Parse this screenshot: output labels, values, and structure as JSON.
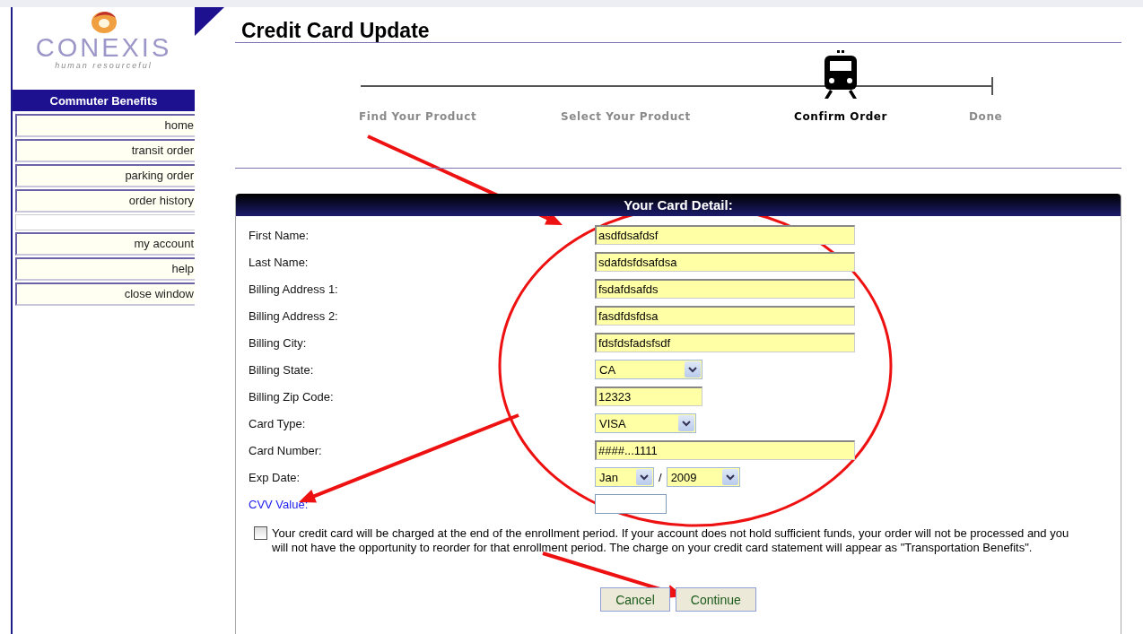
{
  "sidebar": {
    "logo": {
      "name": "CONEXIS",
      "tagline": "human resourceful"
    },
    "heading": "Commuter Benefits",
    "items": [
      {
        "kind": "link",
        "label": "home"
      },
      {
        "kind": "link",
        "label": "transit order"
      },
      {
        "kind": "link",
        "label": "parking order"
      },
      {
        "kind": "link",
        "label": "order history"
      },
      {
        "kind": "spacer"
      },
      {
        "kind": "link",
        "label": "my account"
      },
      {
        "kind": "link",
        "label": "help"
      },
      {
        "kind": "link",
        "label": "close window"
      }
    ]
  },
  "title": "Credit Card Update",
  "steps": [
    {
      "label": "Find Your Product",
      "selected": false
    },
    {
      "label": "Select Your Product",
      "selected": false
    },
    {
      "label": "Confirm Order",
      "selected": true
    },
    {
      "label": "Done",
      "selected": false
    }
  ],
  "panel": {
    "title": "Your Card Detail:",
    "fields": [
      {
        "kind": "text",
        "label": "First Name:",
        "value": "asdfdsafdsf",
        "flagged": false
      },
      {
        "kind": "text",
        "label": "Last Name:",
        "value": "sdafdsfdsafdsa",
        "flagged": false
      },
      {
        "kind": "text",
        "label": "Billing Address 1:",
        "value": "fsdafdsafds",
        "flagged": false
      },
      {
        "kind": "text",
        "label": "Billing Address 2:",
        "value": "fasdfdsfdsa",
        "flagged": false
      },
      {
        "kind": "text",
        "label": "Billing City:",
        "value": "fdsfdsfadsfsdf",
        "flagged": false
      },
      {
        "kind": "select",
        "label": "Billing State:",
        "value": "CA",
        "flagged": false
      },
      {
        "kind": "short",
        "label": "Billing Zip Code:",
        "value": "12323",
        "flagged": false
      },
      {
        "kind": "select",
        "label": "Card Type:",
        "value": "VISA",
        "flagged": false
      },
      {
        "kind": "text",
        "label": "Card Number:",
        "value": "####...1111",
        "flagged": false
      },
      {
        "kind": "date",
        "label": "Exp Date:",
        "month": "Jan",
        "separator": "/",
        "year": "2009",
        "flagged": false
      },
      {
        "kind": "empty",
        "label": "CVV Value:",
        "flagged": true
      }
    ],
    "agreement": {
      "checked": false,
      "text": "Your credit card will be charged at the end of the enrollment period. If your account does not hold sufficient funds, your order will not be processed and you will not have the opportunity to reorder for that enrollment period. The charge on your credit card statement will appear as \"Transportation Benefits\"."
    },
    "buttons": [
      "Cancel",
      "Continue"
    ]
  }
}
